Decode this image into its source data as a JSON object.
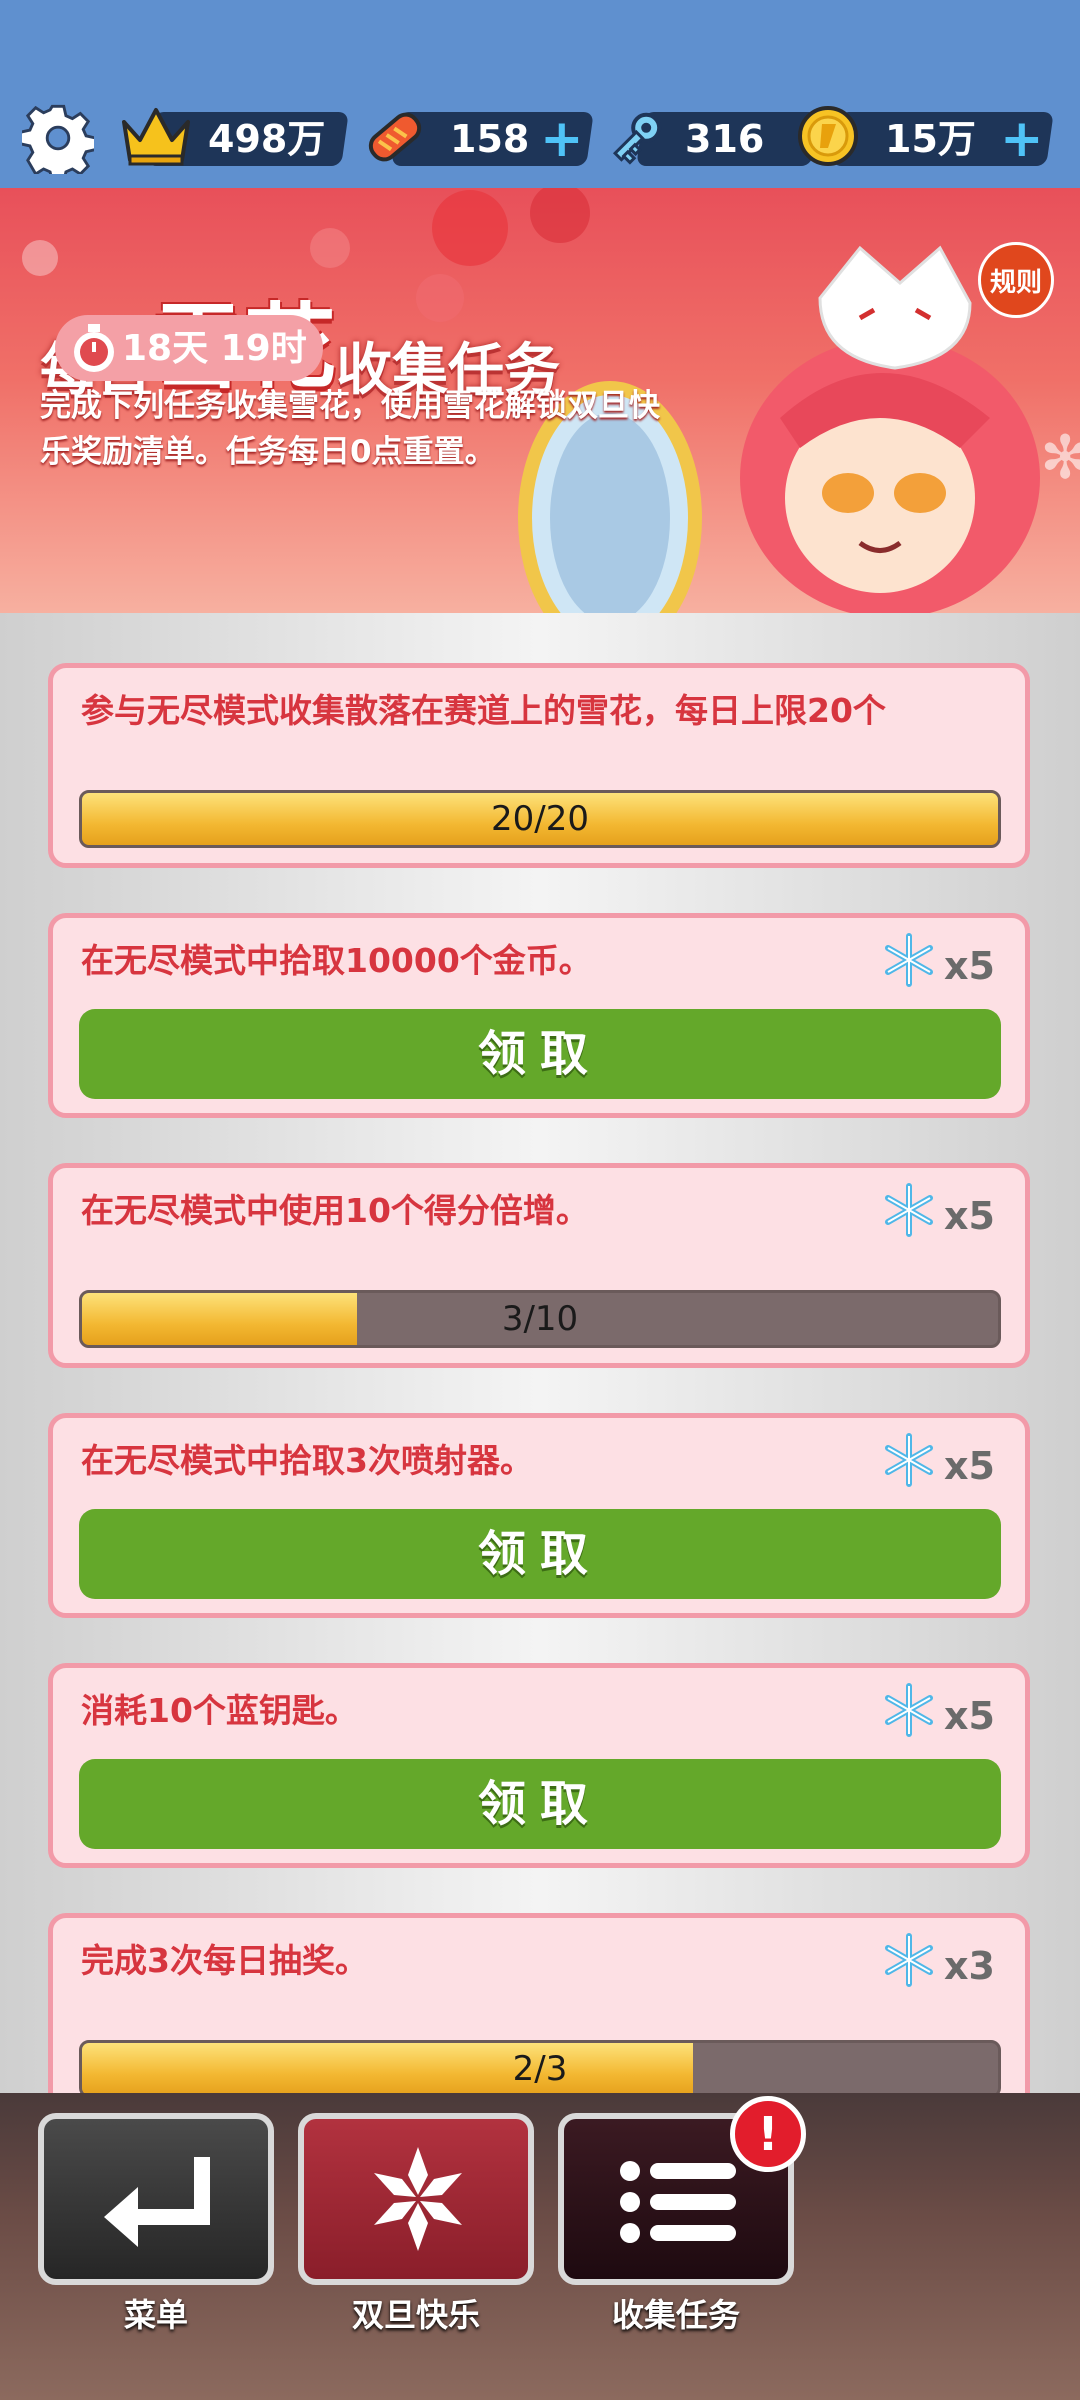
{
  "topbar": {
    "crown_value": "498万",
    "ticket_value": "158",
    "key_value": "316",
    "coin_value": "15万",
    "plus": "+"
  },
  "banner": {
    "title_prefix": "每日",
    "title_highlight": "雪花",
    "title_suffix": "收集任务",
    "description": "完成下列任务收集雪花，使用雪花解锁双旦快乐奖励清单。任务每日0点重置。",
    "timer": "18天 19时",
    "rules_label": "规则"
  },
  "tasks": [
    {
      "text": "参与无尽模式收集散落在赛道上的雪花，每日上限20个",
      "progress_label": "20/20",
      "progress": 1.0
    },
    {
      "text": "在无尽模式中拾取10000个金币。",
      "reward": "x5",
      "claim_label": "领取"
    },
    {
      "text": "在无尽模式中使用10个得分倍增。",
      "reward": "x5",
      "progress_label": "3/10",
      "progress": 0.3
    },
    {
      "text": "在无尽模式中拾取3次喷射器。",
      "reward": "x5",
      "claim_label": "领取"
    },
    {
      "text": "消耗10个蓝钥匙。",
      "reward": "x5",
      "claim_label": "领取"
    },
    {
      "text": "完成3次每日抽奖。",
      "reward": "x3",
      "progress_label": "2/3",
      "progress": 0.6667
    }
  ],
  "nav": {
    "menu_label": "菜单",
    "holiday_label": "双旦快乐",
    "tasks_label": "收集任务",
    "badge": "!"
  },
  "colors": {
    "topbar": "#5f90cf",
    "card_bg": "#fde0e4",
    "card_border": "#f29aa8",
    "task_text": "#d7353f",
    "claim_button": "#64a82a",
    "progress_fill": "#f3b832"
  }
}
